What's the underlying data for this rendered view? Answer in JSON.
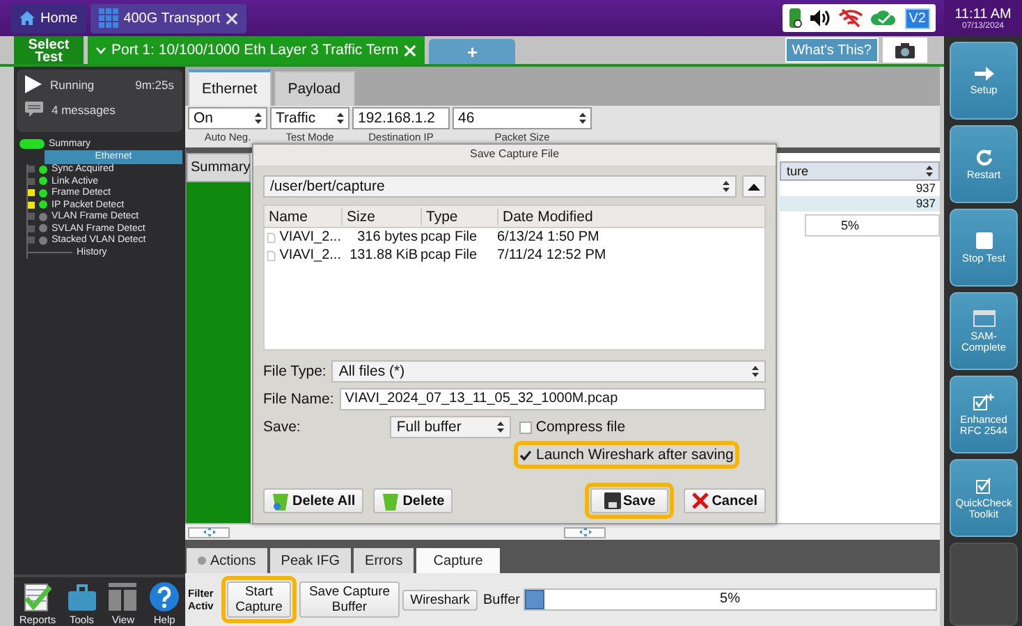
{
  "top_bar": {
    "tabs": [
      {
        "label": "Home",
        "selected": false,
        "kind": "home"
      },
      {
        "label": "400G Transport",
        "selected": true,
        "kind": "app"
      }
    ],
    "profile_badge": "V2",
    "time": "11:11 AM",
    "date": "07/13/2024"
  },
  "test_bar": {
    "select_test": "Select Test",
    "port_tab": "Port 1: 10/100/1000 Eth Layer 3 Traffic Term",
    "add_tab": "+",
    "whats_this": "What's This?"
  },
  "status": {
    "state": "Running",
    "elapsed": "9m:25s",
    "messages": "4 messages"
  },
  "tree": [
    {
      "label": "Summary",
      "color": "#22dd22",
      "selected": false
    },
    {
      "label": "Ethernet",
      "selected": true,
      "children": [
        {
          "label": "Sync Acquired",
          "kind": "led",
          "flagged": false,
          "color": "#22dd22"
        },
        {
          "label": "Link Active",
          "kind": "led",
          "flagged": false,
          "color": "#22dd22"
        },
        {
          "label": "Frame Detect",
          "kind": "led",
          "flagged": true,
          "color": "#22dd22"
        },
        {
          "label": "IP Packet Detect",
          "kind": "led",
          "flagged": true,
          "color": "#22dd22"
        },
        {
          "label": "VLAN Frame Detect",
          "kind": "led",
          "flagged": false,
          "color": "#7a7a7a"
        },
        {
          "label": "SVLAN Frame Detect",
          "kind": "led",
          "flagged": false,
          "color": "#7a7a7a"
        },
        {
          "label": "Stacked VLAN Detect",
          "kind": "led",
          "flagged": false,
          "color": "#7a7a7a"
        },
        {
          "label": "History",
          "kind": "plain"
        }
      ]
    }
  ],
  "bottom_tools": [
    {
      "label": "Reports",
      "kind": "reports"
    },
    {
      "label": "Tools",
      "kind": "tools"
    },
    {
      "label": "View",
      "kind": "view"
    },
    {
      "label": "Help",
      "kind": "help"
    }
  ],
  "setup_tabs": [
    {
      "label": "Ethernet",
      "selected": true
    },
    {
      "label": "Payload",
      "selected": false
    }
  ],
  "settings": [
    {
      "label": "Auto Neg.",
      "value": "On",
      "kind": "select"
    },
    {
      "label": "Test Mode",
      "value": "Traffic",
      "kind": "select"
    },
    {
      "label": "Destination IP",
      "value": "192.168.1.2",
      "kind": "input"
    },
    {
      "label": "Packet Size",
      "value": "46",
      "kind": "select"
    }
  ],
  "results": {
    "summary_tab": "Summary",
    "column_header": "ture",
    "rows": [
      {
        "value": "937",
        "selected": false
      },
      {
        "value": "937",
        "selected": true
      }
    ],
    "reading": "5%"
  },
  "dialog": {
    "title": "Save Capture File",
    "path": "/user/bert/capture",
    "columns": [
      "Name",
      "Size",
      "Type",
      "Date Modified"
    ],
    "files": [
      {
        "name": "VIAVI_2...",
        "size": "316 bytes",
        "type": "pcap File",
        "modified": "6/13/24 1:50 PM"
      },
      {
        "name": "VIAVI_2...",
        "size": "131.88 KiB",
        "type": "pcap File",
        "modified": "7/11/24 12:52 PM"
      }
    ],
    "file_type_label": "File Type:",
    "file_type": "All files (*)",
    "file_name_label": "File Name:",
    "file_name": "VIAVI_2024_07_13_11_05_32_1000M.pcap",
    "save_label": "Save:",
    "save_mode": "Full buffer",
    "options": [
      {
        "label": "Compress file",
        "checked": false,
        "highlighted": false
      },
      {
        "label": "Launch Wireshark after saving",
        "checked": true,
        "highlighted": true
      }
    ],
    "buttons": [
      {
        "label": "Delete All",
        "kind": "delete_all",
        "highlighted": false
      },
      {
        "label": "Delete",
        "kind": "delete",
        "highlighted": false
      },
      {
        "label": "Save",
        "kind": "save",
        "highlighted": true
      },
      {
        "label": "Cancel",
        "kind": "cancel",
        "highlighted": false
      }
    ]
  },
  "bottom_tabs": [
    {
      "label": "Actions",
      "selected": false,
      "kind": "status"
    },
    {
      "label": "Peak IFG",
      "selected": false,
      "kind": "plain"
    },
    {
      "label": "Errors",
      "selected": false,
      "kind": "plain"
    },
    {
      "label": "Capture",
      "selected": true,
      "kind": "plain"
    }
  ],
  "capture": {
    "filter_label": "Filter",
    "active_label": "Activ",
    "buttons": [
      {
        "label": "Start Capture",
        "highlighted": true
      },
      {
        "label": "Save Capture Buffer",
        "highlighted": false
      },
      {
        "label": "Wireshark",
        "highlighted": false
      }
    ],
    "buffer_label": "Buffer",
    "buffer": {
      "level": 0.05,
      "reading": "5%"
    }
  },
  "side_buttons": [
    {
      "label": "Setup",
      "kind": "setup"
    },
    {
      "label": "Restart",
      "kind": "restart"
    },
    {
      "label": "Stop Test",
      "kind": "stop"
    },
    {
      "label": "SAM-Complete",
      "kind": "sam"
    },
    {
      "label": "Enhanced RFC 2544",
      "kind": "rfc"
    },
    {
      "label": "QuickCheck Toolkit",
      "kind": "quickcheck"
    },
    {
      "kind": "blank"
    }
  ]
}
